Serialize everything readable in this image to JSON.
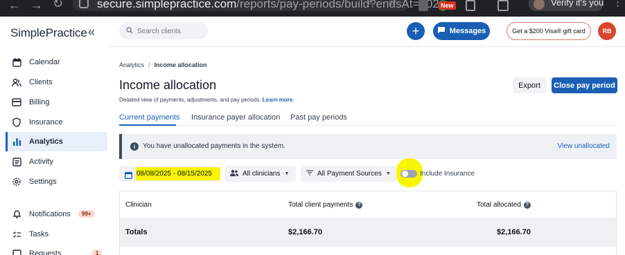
{
  "browser": {
    "url_host": "secure.simplepractice.com",
    "url_path": "/reports/pay-periods/build?endsAt=202...",
    "ext_badge": "New",
    "profile_label": "Verify it's you"
  },
  "sidebar": {
    "logo": "SimplePractice",
    "collapse_icon": "chevrons-left-icon",
    "items": [
      {
        "label": "Calendar",
        "icon": "calendar-icon"
      },
      {
        "label": "Clients",
        "icon": "users-icon"
      },
      {
        "label": "Billing",
        "icon": "card-icon"
      },
      {
        "label": "Insurance",
        "icon": "shield-icon"
      },
      {
        "label": "Analytics",
        "icon": "bar-chart-icon",
        "active": true
      },
      {
        "label": "Activity",
        "icon": "list-icon"
      },
      {
        "label": "Settings",
        "icon": "gear-icon"
      },
      {
        "label": "Notifications",
        "icon": "bell-icon",
        "badge": "99+"
      },
      {
        "label": "Tasks",
        "icon": "check-icon"
      },
      {
        "label": "Requests",
        "icon": "inbox-icon",
        "badge": "1"
      }
    ]
  },
  "header": {
    "search_placeholder": "Search clients",
    "plus_label": "+",
    "messages_label": "Messages",
    "gift_label": "Get a $200 Visa® gift card",
    "user_initials": "RB"
  },
  "page": {
    "breadcrumb": {
      "root": "Analytics",
      "sep": "/",
      "current": "Income allocation"
    },
    "title": "Income allocation",
    "subtitle": "Detailed view of payments, adjustments, and pay periods.",
    "learn_more": "Learn more",
    "subtitle_end": ".",
    "export_label": "Export",
    "close_pay_period_label": "Close pay period",
    "tabs": [
      {
        "label": "Current payments",
        "active": true
      },
      {
        "label": "Insurance payer allocation"
      },
      {
        "label": "Past pay periods"
      }
    ],
    "alert": {
      "icon_text": "i",
      "text": "You have unallocated payments in the system.",
      "link": "View unallocated"
    },
    "filters": {
      "date_range": "08/08/2025 - 08/15/2025",
      "clinicians": "All clinicians",
      "payment_sources": "All Payment Sources",
      "include_insurance_label": "Include Insurance",
      "include_insurance_on": false,
      "highlight_color": "#f7f500"
    },
    "table": {
      "headers": {
        "clinician": "Clinician",
        "client_payments": "Total client payments",
        "allocated": "Total allocated"
      },
      "totals": {
        "label": "Totals",
        "client_payments": "$2,166.70",
        "allocated": "$2,166.70"
      }
    }
  },
  "colors": {
    "brand": "#1a5fb4",
    "avatar": "#d9452e"
  }
}
